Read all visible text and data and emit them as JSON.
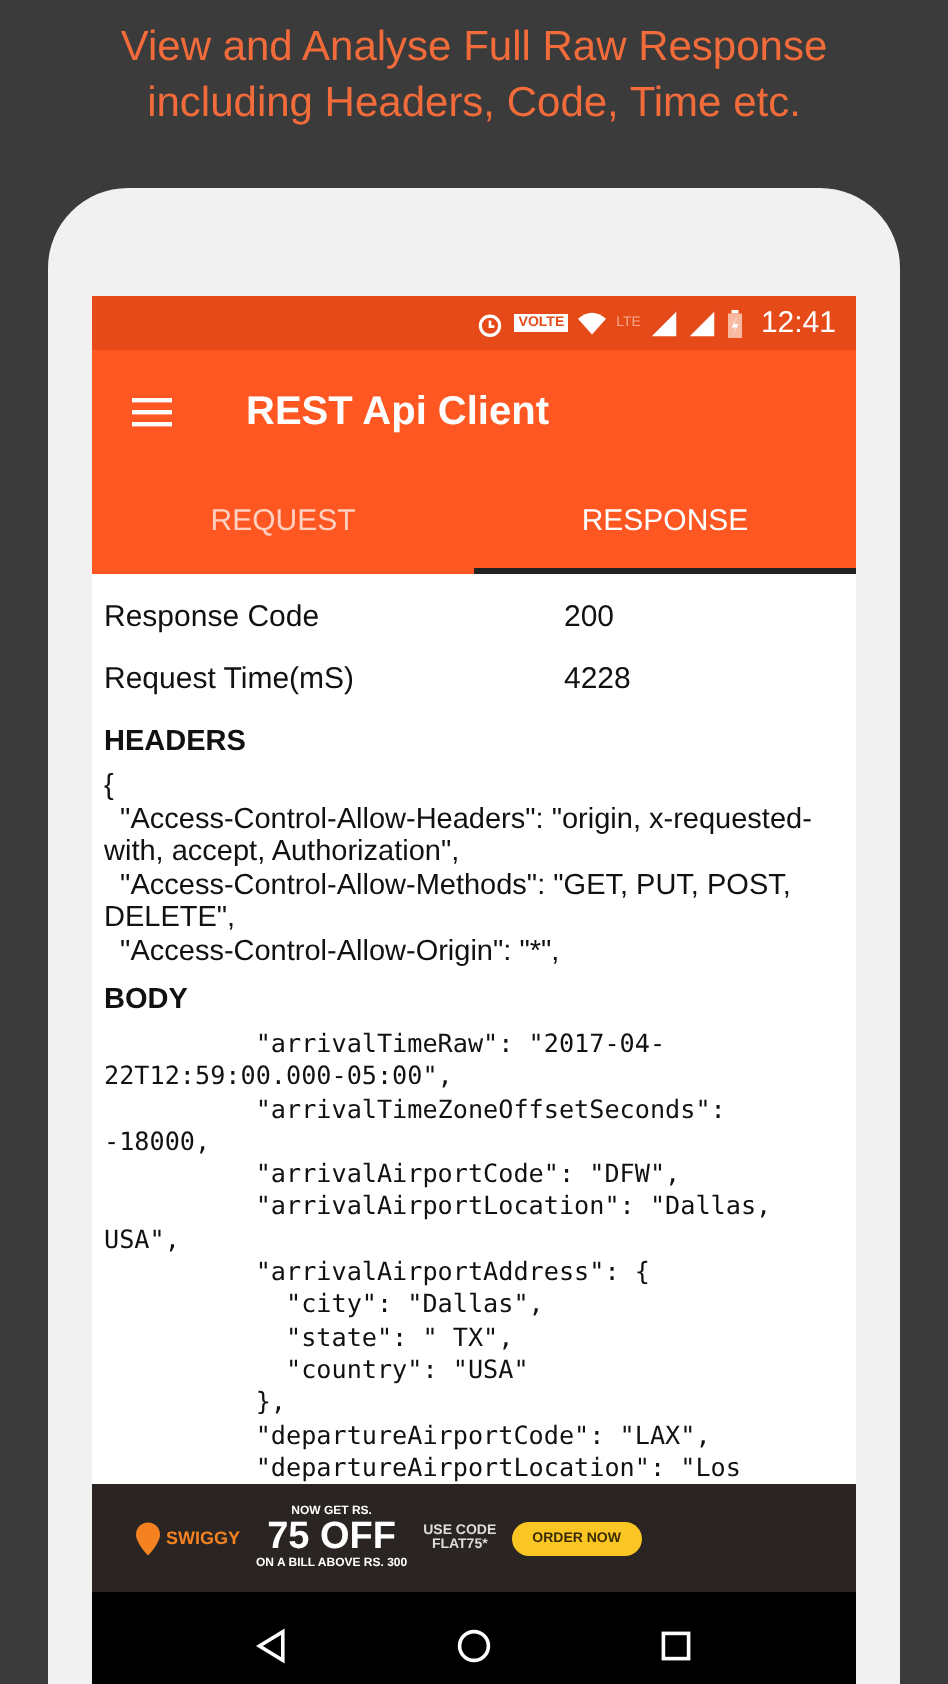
{
  "promo": {
    "caption": "View and Analyse Full Raw Response including Headers, Code, Time etc."
  },
  "status_bar": {
    "network_badge": "VOLTE",
    "lte_label": "LTE",
    "time": "12:41"
  },
  "app_bar": {
    "title": "REST Api Client"
  },
  "tabs": [
    {
      "label": "REQUEST",
      "selected": false
    },
    {
      "label": "RESPONSE",
      "selected": true
    }
  ],
  "summary": [
    {
      "label": "Response Code",
      "value": "200"
    },
    {
      "label": "Request Time(mS)",
      "value": "4228"
    }
  ],
  "headers": {
    "title": "HEADERS",
    "lines": [
      "{",
      "  \"Access-Control-Allow-Headers\": \"origin, x-requested-",
      "with, accept, Authorization\",",
      "  \"Access-Control-Allow-Methods\": \"GET, PUT, POST,",
      "DELETE\",",
      "  \"Access-Control-Allow-Origin\": \"*\","
    ]
  },
  "body": {
    "title": "BODY",
    "lines": [
      "          \"arrivalTimeRaw\": \"2017-04-",
      "22T12:59:00.000-05:00\",",
      "          \"arrivalTimeZoneOffsetSeconds\":",
      "-18000,",
      "          \"arrivalAirportCode\": \"DFW\",",
      "          \"arrivalAirportLocation\": \"Dallas,",
      "USA\",",
      "          \"arrivalAirportAddress\": {",
      "            \"city\": \"Dallas\",",
      "            \"state\": \" TX\",",
      "            \"country\": \"USA\"",
      "          },",
      "          \"departureAirportCode\": \"LAX\",",
      "          \"departureAirportLocation\": \"Los"
    ]
  },
  "ad_banner": {
    "brand": "SWIGGY",
    "offer_top": "NOW GET RS.",
    "offer_main": "75 OFF",
    "offer_bottom": "ON A BILL ABOVE RS. 300",
    "code_label": "USE CODE",
    "code": "FLAT75*",
    "button": "ORDER NOW"
  }
}
